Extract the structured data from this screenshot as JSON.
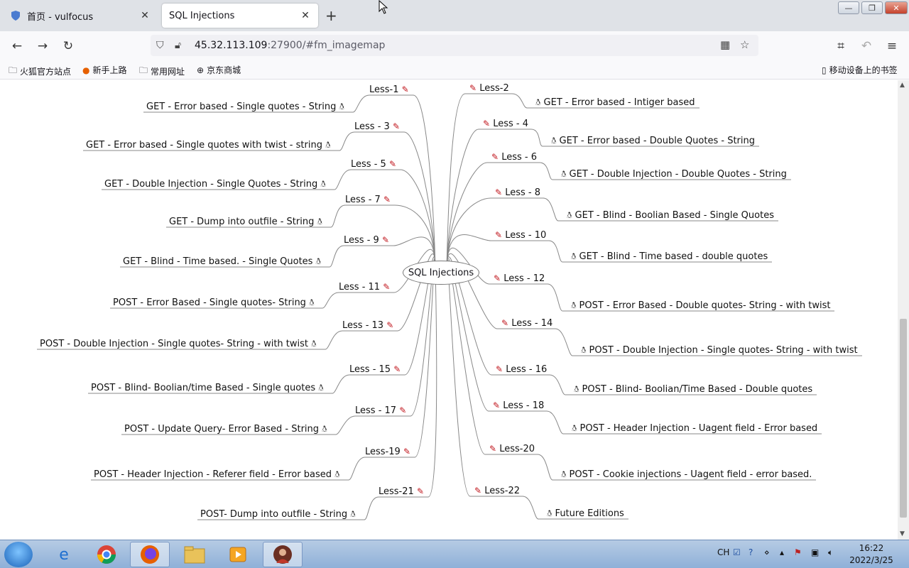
{
  "tabs": [
    {
      "title": "首页 - vulfocus",
      "active": false
    },
    {
      "title": "SQL Injections",
      "active": true
    }
  ],
  "url": {
    "host": "45.32.113.109",
    "rest": ":27900/#fm_imagemap"
  },
  "bookmarks": [
    "火狐官方站点",
    "新手上路",
    "常用网址",
    "京东商城"
  ],
  "mobile_bookmarks": "移动设备上的书签",
  "mindmap": {
    "center": "SQL Injections",
    "left": [
      {
        "less": "Less-1",
        "desc": "GET - Error based - Single quotes - String"
      },
      {
        "less": "Less - 3",
        "desc": "GET - Error based - Single quotes with twist - string"
      },
      {
        "less": "Less - 5",
        "desc": "GET - Double Injection - Single Quotes - String"
      },
      {
        "less": "Less - 7",
        "desc": "GET - Dump into outfile - String"
      },
      {
        "less": "Less - 9",
        "desc": "GET - Blind - Time based. -  Single Quotes"
      },
      {
        "less": "Less - 11",
        "desc": "POST - Error Based - Single quotes- String"
      },
      {
        "less": "Less - 13",
        "desc": "POST - Double Injection - Single quotes- String - with twist"
      },
      {
        "less": "Less - 15",
        "desc": "POST - Blind- Boolian/time Based - Single quotes"
      },
      {
        "less": "Less - 17",
        "desc": "POST - Update Query- Error Based - String"
      },
      {
        "less": "Less-19",
        "desc": "POST - Header Injection - Referer field - Error based"
      },
      {
        "less": "Less-21",
        "desc": "POST- Dump into outfile - String"
      }
    ],
    "right": [
      {
        "less": "Less-2",
        "desc": "GET - Error based - Intiger based"
      },
      {
        "less": "Less - 4",
        "desc": "GET - Error based - Double Quotes - String"
      },
      {
        "less": "Less - 6",
        "desc": "GET - Double Injection - Double Quotes - String"
      },
      {
        "less": "Less - 8",
        "desc": "GET - Blind - Boolian Based - Single Quotes"
      },
      {
        "less": "Less - 10",
        "desc": "GET - Blind - Time based - double quotes"
      },
      {
        "less": "Less - 12",
        "desc": "POST - Error Based - Double quotes- String - with twist"
      },
      {
        "less": "Less - 14",
        "desc": "POST - Double Injection - Single quotes- String - with twist"
      },
      {
        "less": "Less - 16",
        "desc": "POST - Blind- Boolian/Time Based - Double quotes"
      },
      {
        "less": "Less - 18",
        "desc": "POST - Header Injection - Uagent field - Error based"
      },
      {
        "less": "Less-20",
        "desc": "POST - Cookie injections - Uagent field - error based."
      },
      {
        "less": "Less-22",
        "desc": "Future Editions"
      }
    ]
  },
  "taskbar": {
    "lang": "CH",
    "time": "16:22",
    "date": "2022/3/25"
  }
}
